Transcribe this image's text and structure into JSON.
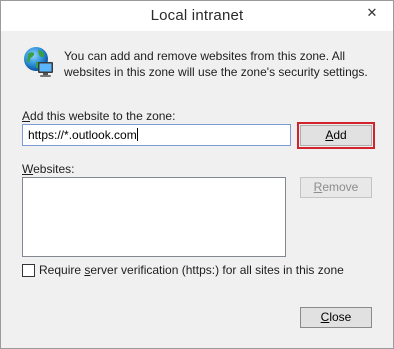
{
  "window": {
    "title": "Local intranet",
    "close_glyph": "✕"
  },
  "icons": {
    "zone": "globe-with-computer-icon"
  },
  "description": "You can add and remove websites from this zone. All websites in this zone will use the zone's security settings.",
  "add_site": {
    "label_accel": "A",
    "label_rest": "dd this website to the zone:",
    "value": "https://*.outlook.com",
    "button_accel": "A",
    "button_rest": "dd"
  },
  "websites": {
    "label_accel": "W",
    "label_rest": "ebsites:",
    "items": [],
    "remove_accel": "R",
    "remove_rest": "emove"
  },
  "require_verification": {
    "checked": false,
    "label_pre": "Require ",
    "label_accel": "s",
    "label_post": "erver verification (https:) for all sites in this zone"
  },
  "close_button": {
    "accel": "C",
    "rest": "lose"
  },
  "colors": {
    "dialog_bg": "#f0f0f0",
    "highlight_outline": "#d0232b",
    "input_border": "#7a9cd3"
  }
}
